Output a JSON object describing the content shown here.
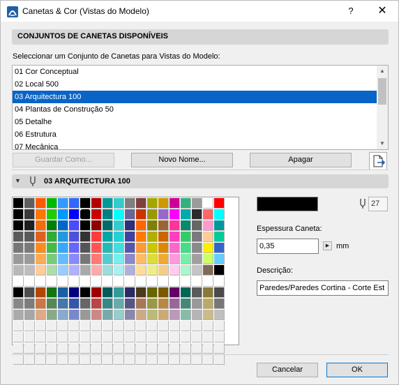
{
  "window": {
    "title": "Canetas & Cor (Vistas do Modelo)",
    "help": "?",
    "close": "✕"
  },
  "penSets": {
    "header": "CONJUNTOS DE CANETAS DISPONÍVEIS",
    "instruction": "Seleccionar um Conjunto de Canetas para Vistas do Modelo:",
    "items": [
      "01 Cor Conceptual",
      "02 Local 500",
      "03 Arquitectura 100",
      "04 Plantas de Construção 50",
      "05 Detalhe",
      "06 Estrutura",
      "07 Mecânica"
    ],
    "selected_index": 2,
    "buttons": {
      "store": "Guardar Como...",
      "new_name": "Novo Nome...",
      "delete": "Apagar"
    }
  },
  "current": {
    "name": "03 ARQUITECTURA 100",
    "pen_number": "27",
    "pen_color": "#000000",
    "thickness_label": "Espessura Caneta:",
    "thickness_value": "0,35",
    "unit": "mm",
    "description_label": "Descrição:",
    "description_value": "Paredes/Paredes Cortina - Corte Est"
  },
  "palette_rows": [
    [
      "#000000",
      "#5f5f5f",
      "#ff5a00",
      "#00ba00",
      "#3399ff",
      "#3366ff",
      "#000000",
      "#b40000",
      "#009999",
      "#33cccc",
      "#7f7f7f",
      "#804040",
      "#a6a600",
      "#cc9900",
      "#cc0099",
      "#33b280",
      "#9b9b9b",
      "#ffffff",
      "#ff0000"
    ],
    [
      "#000000",
      "#3a3a3a",
      "#ff7700",
      "#21cc00",
      "#0099ff",
      "#0000ff",
      "#000000",
      "#cc0000",
      "#008080",
      "#00ffff",
      "#666699",
      "#cc3300",
      "#999900",
      "#9966cc",
      "#ff00ff",
      "#00aaaa",
      "#2b2b2b",
      "#ff6666",
      "#00ffff"
    ],
    [
      "#000000",
      "#1f1f1f",
      "#f26b0f",
      "#008000",
      "#0066cc",
      "#4a4aff",
      "#000000",
      "#8b0000",
      "#006b6b",
      "#33cccc",
      "#2e2e7a",
      "#ff6600",
      "#808000",
      "#996633",
      "#ff3399",
      "#0a8a6a",
      "#666666",
      "#ff99cc",
      "#009999"
    ],
    [
      "#5a5a5a",
      "#595959",
      "#e06020",
      "#33aa33",
      "#2299dd",
      "#5050e0",
      "#333333",
      "#ff3b3b",
      "#00a6a6",
      "#20d2d2",
      "#4040a0",
      "#ff7a00",
      "#b0b000",
      "#cc6600",
      "#ff3fbf",
      "#33cc66",
      "#7a7a7a",
      "#ffcc99",
      "#00cc99"
    ],
    [
      "#777777",
      "#7a7a7a",
      "#ff8c1a",
      "#44bb44",
      "#33aaff",
      "#6666ff",
      "#555555",
      "#ff5555",
      "#22bbbb",
      "#44dddd",
      "#5656b0",
      "#ff9933",
      "#c8c800",
      "#dd8800",
      "#ff66cc",
      "#44dd88",
      "#8a8a8a",
      "#ffee00",
      "#3366cc"
    ],
    [
      "#999999",
      "#9a9a9a",
      "#ffaa55",
      "#77cc77",
      "#66bbff",
      "#8888ff",
      "#777777",
      "#ff7777",
      "#55cccc",
      "#77eeee",
      "#8888cc",
      "#ffbb66",
      "#dddd33",
      "#eeaa33",
      "#ff99dd",
      "#77eeaa",
      "#a0a0a0",
      "#ccff66",
      "#66ccff"
    ],
    [
      "#b8b8b8",
      "#bdbdbd",
      "#ffcc99",
      "#aaddaa",
      "#99ccff",
      "#b0b0ff",
      "#aaaaaa",
      "#ffaaaa",
      "#99dddd",
      "#aaf0f0",
      "#b0b0dd",
      "#ffdd99",
      "#eeee88",
      "#f5cc88",
      "#ffccee",
      "#aaf5cc",
      "#c4c4c4",
      "#7f6a55",
      "#000000"
    ],
    [
      "#ffffff",
      "#ffffff",
      "#ffffff",
      "#ffffff",
      "#ffffff",
      "#ffffff",
      "#ffffff",
      "#ffffff",
      "#ffffff",
      "#ffffff",
      "#ffffff",
      "#ffffff",
      "#ffffff",
      "#ffffff",
      "#ffffff",
      "#ffffff",
      "#ffffff",
      "#ffffff",
      "#ffffff"
    ],
    [
      "#000000",
      "#4d4d4d",
      "#b34700",
      "#117711",
      "#1a5ea6",
      "#000080",
      "#000000",
      "#a00000",
      "#005c5c",
      "#339999",
      "#2a2a66",
      "#4d3a1a",
      "#666600",
      "#7a5a00",
      "#660066",
      "#006655",
      "#5a5a5a",
      "#8a7a3a",
      "#4a4a4a"
    ],
    [
      "#888888",
      "#7d7d7d",
      "#cc7744",
      "#558855",
      "#4477aa",
      "#3355aa",
      "#666666",
      "#bb4444",
      "#338888",
      "#66aaaa",
      "#555588",
      "#aa7755",
      "#999944",
      "#bb8844",
      "#996699",
      "#448877",
      "#999999",
      "#bbaa66",
      "#777777"
    ],
    [
      "#aaaaaa",
      "#a6a6a6",
      "#ddaa88",
      "#88aa88",
      "#88aacc",
      "#7788cc",
      "#999999",
      "#cc8888",
      "#77aaaa",
      "#99cccc",
      "#8888aa",
      "#ccaa88",
      "#bbbb77",
      "#ccaa77",
      "#bb99bb",
      "#88bbaa",
      "#b5b5b5",
      "#ccbb88",
      "#bfbfbf"
    ],
    [
      "#f0f0f0",
      "#f0f0f0",
      "#f0f0f0",
      "#f0f0f0",
      "#f0f0f0",
      "#f0f0f0",
      "#f0f0f0",
      "#f0f0f0",
      "#f0f0f0",
      "#f0f0f0",
      "#f0f0f0",
      "#f0f0f0",
      "#f0f0f0",
      "#f0f0f0",
      "#f0f0f0",
      "#f0f0f0",
      "#f0f0f0",
      "#f0f0f0",
      "#f0f0f0"
    ],
    [
      "#f0f0f0",
      "#f0f0f0",
      "#f0f0f0",
      "#f0f0f0",
      "#f0f0f0",
      "#f0f0f0",
      "#f0f0f0",
      "#f0f0f0",
      "#f0f0f0",
      "#f0f0f0",
      "#f0f0f0",
      "#f0f0f0",
      "#f0f0f0",
      "#f0f0f0",
      "#f0f0f0",
      "#f0f0f0",
      "#f0f0f0",
      "#f0f0f0",
      "#f0f0f0"
    ],
    [
      "#f0f0f0",
      "#f0f0f0",
      "#f0f0f0",
      "#f0f0f0",
      "#f0f0f0",
      "#f0f0f0",
      "#f0f0f0",
      "#f0f0f0",
      "#f0f0f0",
      "#f0f0f0",
      "#f0f0f0",
      "#f0f0f0",
      "#f0f0f0",
      "#f0f0f0",
      "#f0f0f0",
      "#f0f0f0",
      "#f0f0f0",
      "#f0f0f0",
      "#f0f0f0"
    ],
    [
      "#f0f0f0",
      "#f0f0f0",
      "#f0f0f0",
      "#f0f0f0",
      "#f0f0f0",
      "#f0f0f0",
      "#f0f0f0",
      "#f0f0f0",
      "#f0f0f0",
      "#f0f0f0",
      "#f0f0f0",
      "#f0f0f0",
      "#f0f0f0",
      "#f0f0f0",
      "#f0f0f0",
      "#f0f0f0",
      "#f0f0f0",
      "#f0f0f0",
      "#f0f0f0"
    ]
  ],
  "selected_cell": [
    1,
    6
  ],
  "footer": {
    "cancel": "Cancelar",
    "ok": "OK"
  },
  "colors": {
    "selection": "#0a64c8",
    "accent": "#0078d7",
    "archicad_icon": "#1f5fa8"
  }
}
